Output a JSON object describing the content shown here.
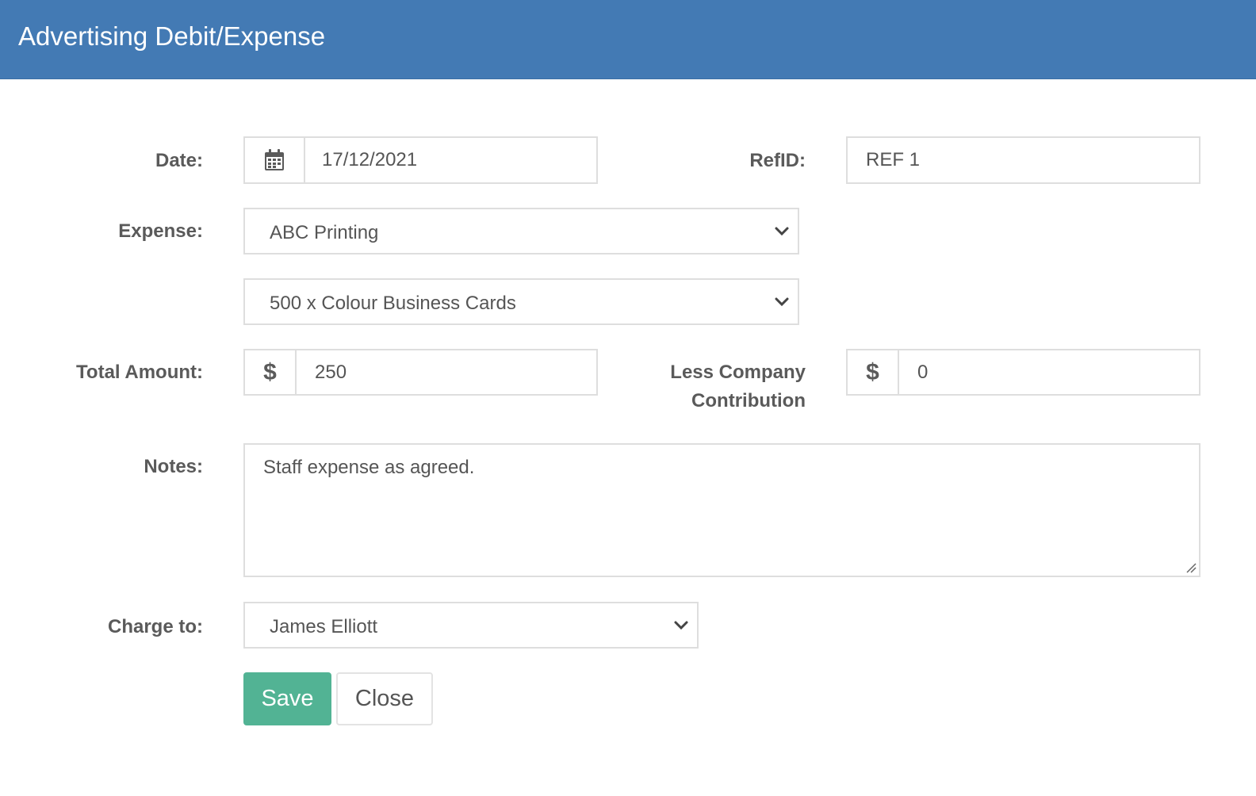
{
  "dialog": {
    "title": "Advertising Debit/Expense"
  },
  "form": {
    "date": {
      "label": "Date:",
      "value": "17/12/2021",
      "icon": "calendar-icon"
    },
    "refid": {
      "label": "RefID:",
      "value": "REF 1"
    },
    "expense": {
      "label": "Expense:",
      "supplier": "ABC Printing",
      "item": "500 x Colour Business Cards"
    },
    "total_amount": {
      "label": "Total Amount:",
      "currency": "$",
      "value": "250"
    },
    "company_contribution": {
      "label_line1": "Less Company",
      "label_line2": "Contribution",
      "currency": "$",
      "value": "0"
    },
    "notes": {
      "label": "Notes:",
      "value": "Staff expense as agreed."
    },
    "charge_to": {
      "label": "Charge to:",
      "value": "James Elliott"
    }
  },
  "actions": {
    "save_label": "Save",
    "close_label": "Close"
  },
  "colors": {
    "header": "#437ab4",
    "save_button": "#52b394",
    "border": "#dedede"
  }
}
